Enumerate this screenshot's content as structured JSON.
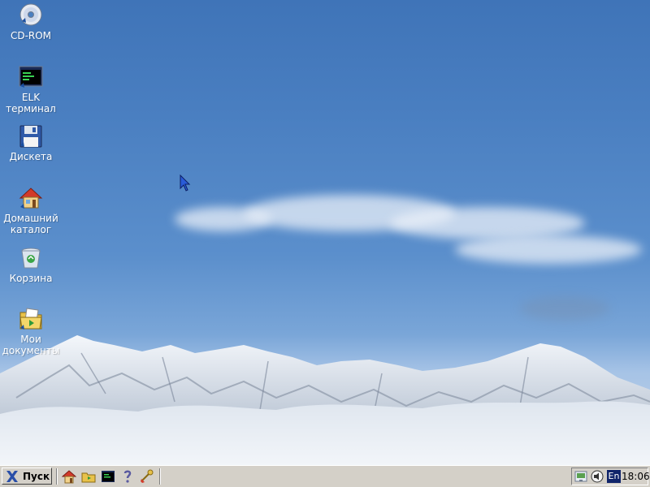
{
  "desktop": {
    "icons": [
      {
        "label_line1": "CD-ROM",
        "label_line2": "",
        "icon": "cdrom-icon"
      },
      {
        "label_line1": "ELK",
        "label_line2": "терминал",
        "icon": "terminal-icon"
      },
      {
        "label_line1": "Дискета",
        "label_line2": "",
        "icon": "floppy-icon"
      },
      {
        "label_line1": "Домашний",
        "label_line2": "каталог",
        "icon": "home-icon"
      },
      {
        "label_line1": "Корзина",
        "label_line2": "",
        "icon": "trash-icon"
      },
      {
        "label_line1": "Мои",
        "label_line2": "документы",
        "icon": "documents-icon"
      }
    ]
  },
  "taskbar": {
    "start_label": "Пуск",
    "quicklaunch": [
      "home-icon",
      "folder-icon",
      "terminal-icon",
      "help-icon",
      "settings-icon"
    ],
    "tray": {
      "language": "En",
      "clock": "18:06",
      "icons": [
        "network-icon",
        "volume-icon"
      ]
    }
  }
}
